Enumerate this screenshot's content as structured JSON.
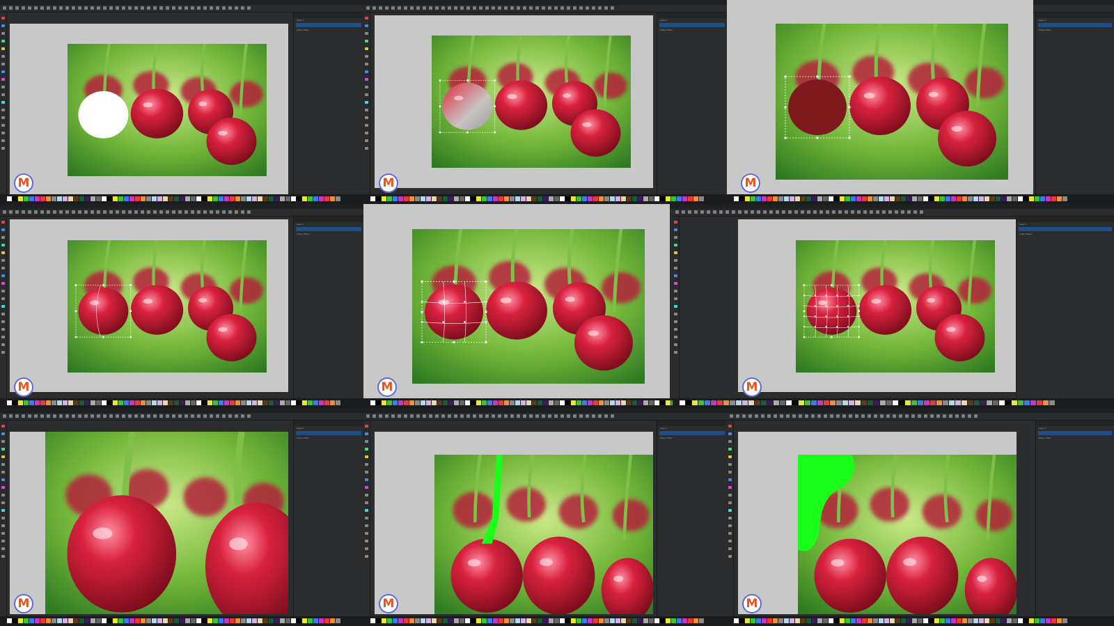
{
  "app": {
    "logo_letter": "M",
    "logo_color": "#e8541e",
    "logo_ring_color": "#5a67d8"
  },
  "panels": {
    "layers_title": "Layers and Objects",
    "layer_name": "Layer 1",
    "path_name": "path1",
    "photo_name": "Cherry Photo"
  },
  "colors": {
    "ui_dark": "#2b2c2e",
    "canvas_gray": "#c8c8c8",
    "selection_blue": "#1f4f8a",
    "cherry_red": "#c81d3a",
    "cherry_dark": "#7e1a1e",
    "stem_green": "#7fc04a",
    "mask_green": "#19ff19"
  },
  "steps": [
    {
      "id": 1,
      "state": "white-fill-circle"
    },
    {
      "id": 2,
      "state": "gradient-fill-circle"
    },
    {
      "id": 3,
      "state": "dark-red-fill-circle"
    },
    {
      "id": 4,
      "state": "mesh-selection"
    },
    {
      "id": 5,
      "state": "mesh-grid-editing"
    },
    {
      "id": 6,
      "state": "mesh-grid-dense"
    },
    {
      "id": 7,
      "state": "zoomed-cherry"
    },
    {
      "id": 8,
      "state": "green-stem-path"
    },
    {
      "id": 9,
      "state": "green-blob-path"
    }
  ]
}
